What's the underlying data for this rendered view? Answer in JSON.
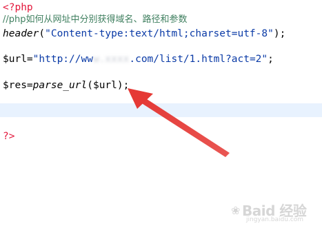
{
  "editor": {
    "line1": {
      "open_tag": "<?php"
    },
    "line2": {
      "comment": "//php如何从网址中分别获得域名、路径和参数"
    },
    "line3": {
      "func": "header",
      "open_paren": "(",
      "string": "\"Content-type:text/html;charset=utf-8\"",
      "close": ");"
    },
    "line5": {
      "var": "$url=",
      "string_start": "\"http://ww",
      "string_blurred": "w.xxxx",
      "string_end": ".com/list/1.html?act=2\"",
      "close": ";"
    },
    "line7": {
      "var": "$res=",
      "func": "parse_url",
      "args": "($url);"
    },
    "line10": {
      "close_tag": "?>"
    }
  },
  "annotation": {
    "arrow_color": "#e53935"
  },
  "watermark": {
    "brand": "Baid 经验",
    "url": "jingyan.baidu.com"
  }
}
